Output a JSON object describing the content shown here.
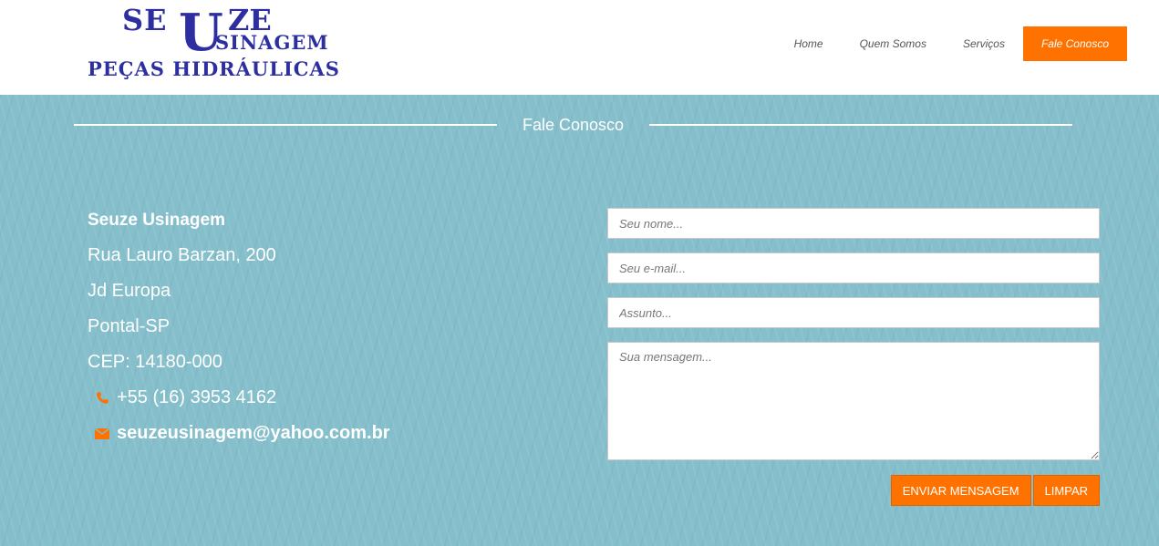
{
  "logo": {
    "line1_left": "SE",
    "line1_big": "U",
    "line1_right": "ZE",
    "line2": "SINAGEM",
    "line3": "PEÇAS HIDRÁULICAS"
  },
  "nav": {
    "items": [
      "Home",
      "Quem Somos",
      "Serviços",
      "Fale Conosco"
    ],
    "active_index": 3
  },
  "section": {
    "title": "Fale Conosco"
  },
  "contact": {
    "company": "Seuze Usinagem",
    "street": "Rua Lauro Barzan, 200",
    "district": "Jd Europa",
    "city": "Pontal-SP",
    "cep": "CEP: 14180-000",
    "phone": "+55 (16) 3953 4162",
    "email": "seuzeusinagem@yahoo.com.br"
  },
  "form": {
    "name_placeholder": "Seu nome...",
    "email_placeholder": "Seu e-mail...",
    "subject_placeholder": "Assunto...",
    "message_placeholder": "Sua mensagem...",
    "submit_label": "ENVIAR MENSAGEM",
    "clear_label": "LIMPAR"
  },
  "colors": {
    "accent": "#ff7200",
    "background": "#86bfcc",
    "logo": "#2d2fa0"
  },
  "icons": {
    "phone": "phone-icon",
    "email": "envelope-icon"
  }
}
